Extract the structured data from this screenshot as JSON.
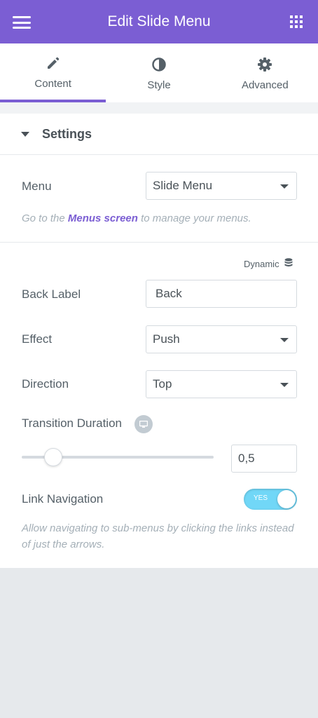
{
  "header": {
    "title": "Edit Slide Menu",
    "menu_icon": "hamburger-icon",
    "apps_icon": "grid-icon",
    "background": "#7b5ed3"
  },
  "tabs": [
    {
      "label": "Content",
      "icon": "pencil-icon",
      "active": true
    },
    {
      "label": "Style",
      "icon": "half-circle-icon",
      "active": false
    },
    {
      "label": "Advanced",
      "icon": "gear-icon",
      "active": false
    }
  ],
  "section": {
    "title": "Settings"
  },
  "menu": {
    "label": "Menu",
    "value": "Slide Menu",
    "note_prefix": "Go to the ",
    "note_link": "Menus screen",
    "note_suffix": " to manage your menus."
  },
  "dynamic": {
    "label": "Dynamic",
    "icon": "database-icon"
  },
  "back_label": {
    "label": "Back Label",
    "value": "Back"
  },
  "effect": {
    "label": "Effect",
    "value": "Push"
  },
  "direction": {
    "label": "Direction",
    "value": "Top"
  },
  "transition": {
    "label": "Transition Duration",
    "icon": "monitor-icon",
    "value": "0,5"
  },
  "link_navigation": {
    "label": "Link Navigation",
    "toggle_text": "YES",
    "enabled": true,
    "description": "Allow navigating to sub-menus by clicking the links instead of just the arrows."
  },
  "colors": {
    "accent": "#7b5ed3",
    "toggle_on": "#71d7f7"
  }
}
